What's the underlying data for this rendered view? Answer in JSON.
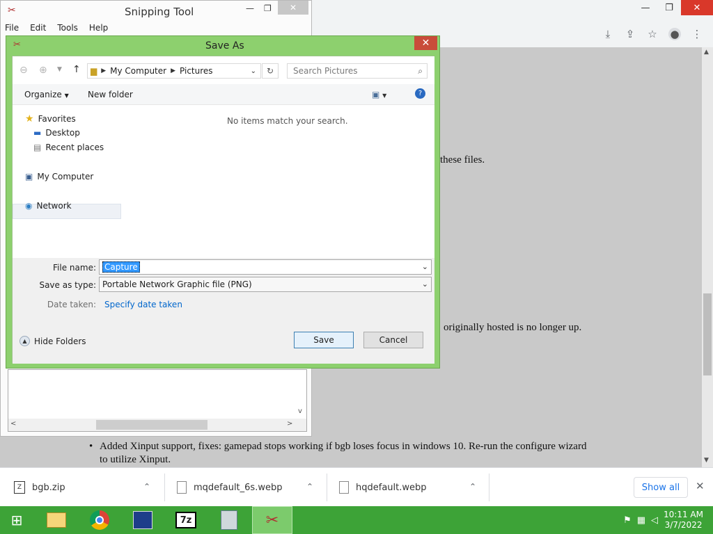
{
  "snipping_tool": {
    "title": "Snipping Tool",
    "menu": [
      "File",
      "Edit",
      "Tools",
      "Help"
    ]
  },
  "browser": {
    "page_text": [
      "these files.",
      "originally hosted is no longer up.",
      "Added Xinput support, fixes: gamepad stops working if bgb loses focus in windows 10. Re-run the configure wizard",
      "to utilize Xinput."
    ]
  },
  "dialog": {
    "title": "Save As",
    "breadcrumb": [
      "My Computer",
      "Pictures"
    ],
    "search_placeholder": "Search Pictures",
    "toolbar": {
      "organize": "Organize",
      "new_folder": "New folder"
    },
    "nav": {
      "favorites": "Favorites",
      "desktop": "Desktop",
      "recent": "Recent places",
      "my_computer": "My Computer",
      "network": "Network"
    },
    "empty_message": "No items match your search.",
    "file_name_label": "File name:",
    "file_name_value": "Capture",
    "save_type_label": "Save as type:",
    "save_type_value": "Portable Network Graphic file (PNG)",
    "date_label": "Date taken:",
    "date_link": "Specify date taken",
    "hide_folders": "Hide Folders",
    "save": "Save",
    "cancel": "Cancel"
  },
  "downloads": {
    "items": [
      "bgb.zip",
      "mqdefault_6s.webp",
      "hqdefault.webp"
    ],
    "show_all": "Show all"
  },
  "taskbar": {
    "time": "10:11 AM",
    "date": "3/7/2022",
    "apps": [
      "file-explorer",
      "chrome",
      "app-editor",
      "7zip",
      "calculator",
      "snipping-tool"
    ]
  },
  "colors": {
    "dialog_frame": "#8dd06e",
    "taskbar": "#3da337",
    "link": "#0066cc"
  }
}
